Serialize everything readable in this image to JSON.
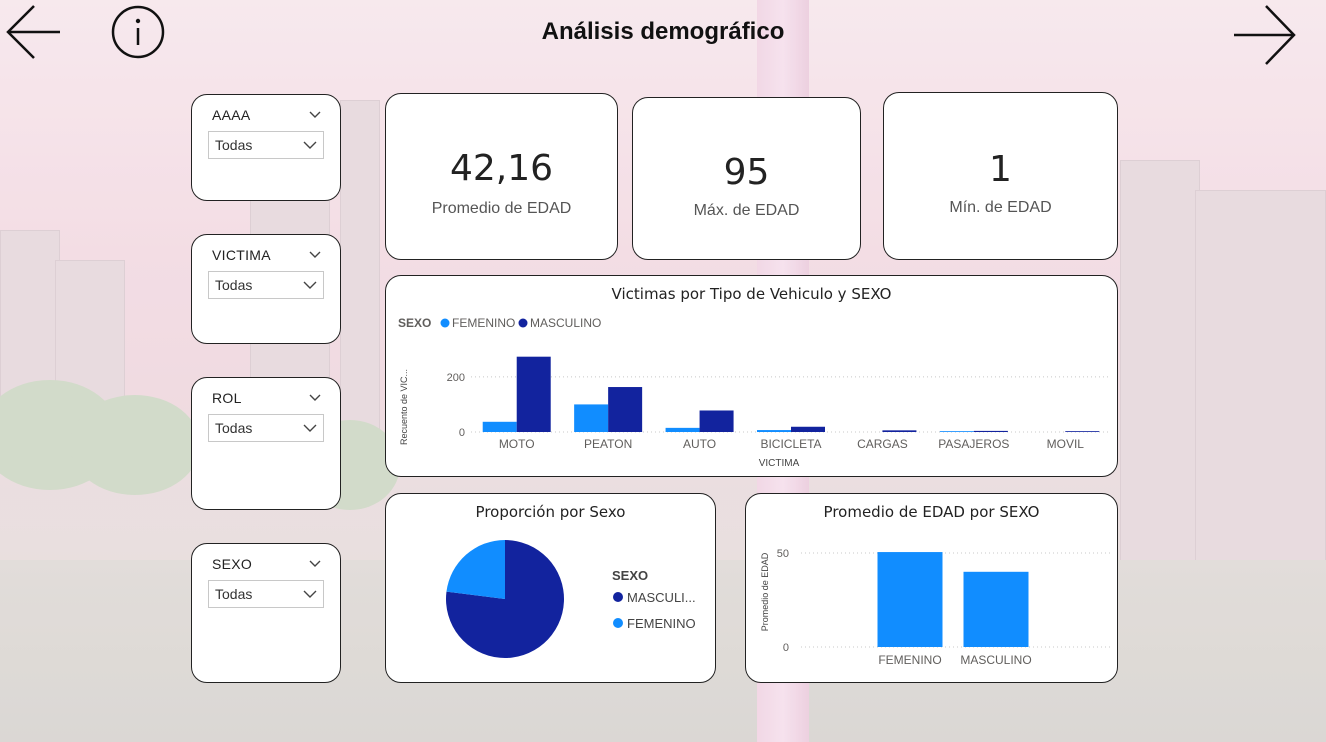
{
  "page": {
    "title": "Análisis demográfico"
  },
  "colors": {
    "femenino": "#118DFF",
    "masculino": "#12239E",
    "text": "#222222",
    "axis": "#605E5C"
  },
  "icons": {
    "back": "arrow-left-icon",
    "info": "info-circle-icon",
    "forward": "arrow-right-icon"
  },
  "slicers": [
    {
      "title": "AAAA",
      "value": "Todas"
    },
    {
      "title": "VICTIMA",
      "value": "Todas"
    },
    {
      "title": "ROL",
      "value": "Todas"
    },
    {
      "title": "SEXO",
      "value": "Todas"
    }
  ],
  "kpis": [
    {
      "value": "42,16",
      "label": "Promedio de EDAD"
    },
    {
      "value": "95",
      "label": "Máx. de EDAD"
    },
    {
      "value": "1",
      "label": "Mín. de EDAD"
    }
  ],
  "chart_data": [
    {
      "type": "bar",
      "title": "Victimas por Tipo de Vehiculo y SEXO",
      "legend_title": "SEXO",
      "legend_position": "top-left",
      "xlabel": "VICTIMA",
      "ylabel": "Recuento de VIC...",
      "yticks": [
        "0",
        "200"
      ],
      "ylim": [
        0,
        290
      ],
      "categories": [
        "MOTO",
        "PEATON",
        "AUTO",
        "BICICLETA",
        "CARGAS",
        "PASAJEROS",
        "MOVIL"
      ],
      "series": [
        {
          "name": "FEMENINO",
          "color": "#118DFF",
          "values": [
            37,
            100,
            15,
            7,
            0,
            3,
            0
          ]
        },
        {
          "name": "MASCULINO",
          "color": "#12239E",
          "values": [
            273,
            163,
            78,
            19,
            6,
            4,
            3
          ]
        }
      ],
      "grid": true
    },
    {
      "type": "pie",
      "title": "Proporción por Sexo",
      "legend_title": "SEXO",
      "legend_position": "right",
      "slices": [
        {
          "name": "MASCULI...",
          "color": "#12239E",
          "value": 0.77
        },
        {
          "name": "FEMENINO",
          "color": "#118DFF",
          "value": 0.23
        }
      ]
    },
    {
      "type": "bar",
      "title": "Promedio de EDAD por SEXO",
      "ylabel": "Promedio de EDAD",
      "yticks": [
        "0",
        "50"
      ],
      "ylim": [
        0,
        58
      ],
      "categories": [
        "FEMENINO",
        "MASCULINO"
      ],
      "values": [
        50.5,
        40
      ],
      "color": "#118DFF",
      "grid": true
    }
  ]
}
